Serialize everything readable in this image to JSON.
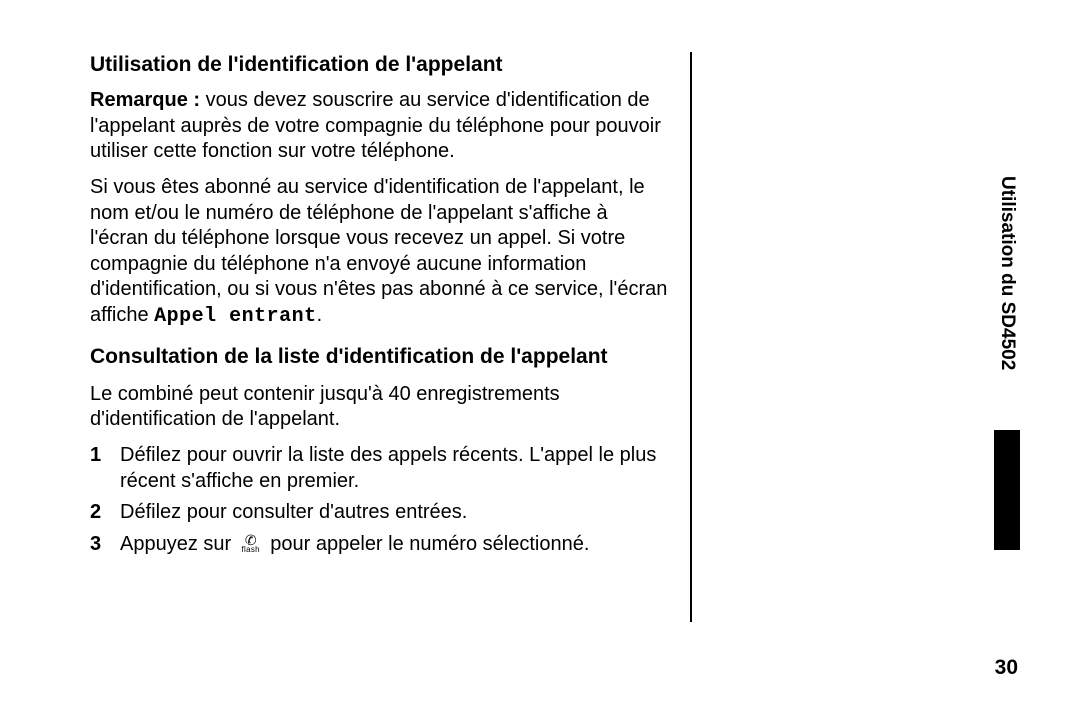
{
  "side_tab": "Utilisation du SD4502",
  "page_number": "30",
  "heading1": "Utilisation de l'identification de l'appelant",
  "note_label": "Remarque :",
  "note_text": " vous devez souscrire au service d'identification de l'appelant auprès de votre compagnie du téléphone pour pouvoir utiliser cette fonction sur votre téléphone.",
  "para2_pre": "Si vous êtes abonné au service d'identification de l'appelant, le nom et/ou le numéro de téléphone de l'appelant s'affiche à l'écran du téléphone lorsque vous recevez un appel. Si votre compagnie du téléphone n'a envoyé aucune information d'identification, ou si vous n'êtes pas abonné à ce service, l'écran affiche ",
  "para2_mono": "Appel entrant",
  "para2_post": ".",
  "heading2": "Consultation de la liste d'identification de l'appelant",
  "intro": "Le combiné peut contenir jusqu'à 40 enregistrements d'identification de l'appelant.",
  "steps": {
    "s1_num": "1",
    "s1": "Défilez pour ouvrir la liste des appels récents. L'appel le plus récent s'affiche en premier.",
    "s2_num": "2",
    "s2": "Défilez pour consulter d'autres entrées.",
    "s3_num": "3",
    "s3_pre": "Appuyez sur ",
    "s3_post": " pour appeler le numéro sélectionné.",
    "flash_label": "flash"
  }
}
